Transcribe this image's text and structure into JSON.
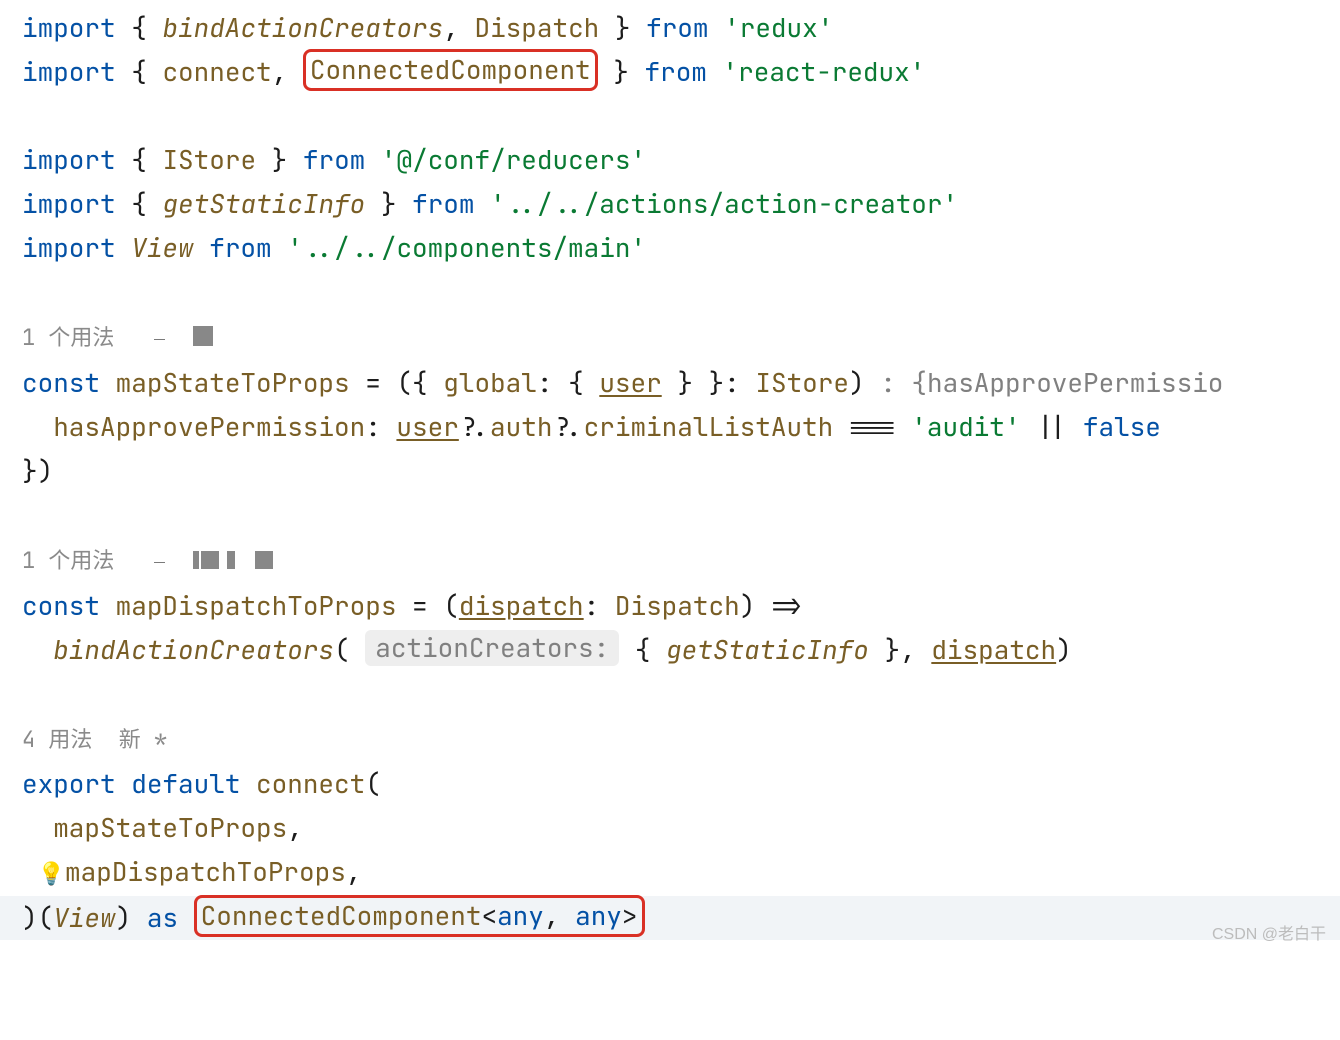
{
  "line1": {
    "import": "import",
    "lcb": "{",
    "bindActionCreators": "bindActionCreators",
    "comma": ",",
    "Dispatch": "Dispatch",
    "rcb": "}",
    "from": "from",
    "mod": "'redux'"
  },
  "line2": {
    "import": "import",
    "lcb": "{",
    "connect": "connect",
    "comma": ",",
    "ConnectedComponent": "ConnectedComponent",
    "rcb": "}",
    "from": "from",
    "mod": "'react-redux'"
  },
  "line4": {
    "import": "import",
    "lcb": "{",
    "IStore": "IStore",
    "rcb": "}",
    "from": "from",
    "mod": "'@/conf/reducers'"
  },
  "line5": {
    "import": "import",
    "lcb": "{",
    "getStaticInfo": "getStaticInfo",
    "rcb": "}",
    "from": "from",
    "mod": "'../../actions/action-creator'"
  },
  "line6": {
    "import": "import",
    "View": "View",
    "from": "from",
    "mod": "'../../components/main'"
  },
  "usages1": "1 个用法",
  "mstp": {
    "const": "const",
    "name": "mapStateToProps",
    "eq": " = (",
    "lcb": "{",
    "global": "global",
    "colon": ":",
    "lcb2": "{",
    "user": "user",
    "rcb2": "}",
    "rcb": "}",
    "colon2": ":",
    "IStore": "IStore",
    "paren": ")",
    "retHint": " : {hasApprovePermissio",
    "body_start": "  hasApprovePermission",
    "colon3": ":",
    "userRef": "user",
    "opt1": "?.",
    "auth": "auth",
    "opt2": "?.",
    "crim": "criminalListAuth",
    "eqeqeq": " === ",
    "audit": "'audit'",
    "or": " || ",
    "false": "false",
    "close": "})"
  },
  "usages2": "1 个用法",
  "mdtp": {
    "const": "const",
    "name": "mapDispatchToProps",
    "eq": " = (",
    "dispatch": "dispatch",
    "colon": ":",
    "Dispatch": "Dispatch",
    "paren": ")",
    "arrow": " =>",
    "bac": "bindActionCreators",
    "lp": "(",
    "paramHint": "actionCreators:",
    "lcb": "{",
    "getStaticInfo": "getStaticInfo",
    "rcb": "}",
    "comma": ",",
    "dispatch2": "dispatch",
    "rp": ")"
  },
  "usages3": "4 用法  新 *",
  "exp": {
    "export": "export",
    "default": "default",
    "connect": "connect",
    "lp": "(",
    "mstp": "mapStateToProps",
    "comma": ",",
    "mdtp": "mapDispatchToProps",
    "comma2": ",",
    "rp": ")",
    "lp2": "(",
    "View": "View",
    "rp2": ")",
    "as": " as",
    "ConnectedComponent": "ConnectedComponent",
    "lt": "<",
    "any1": "any",
    "comma3": ",",
    "any2": "any",
    "gt": ">"
  },
  "watermark": "CSDN @老白干"
}
